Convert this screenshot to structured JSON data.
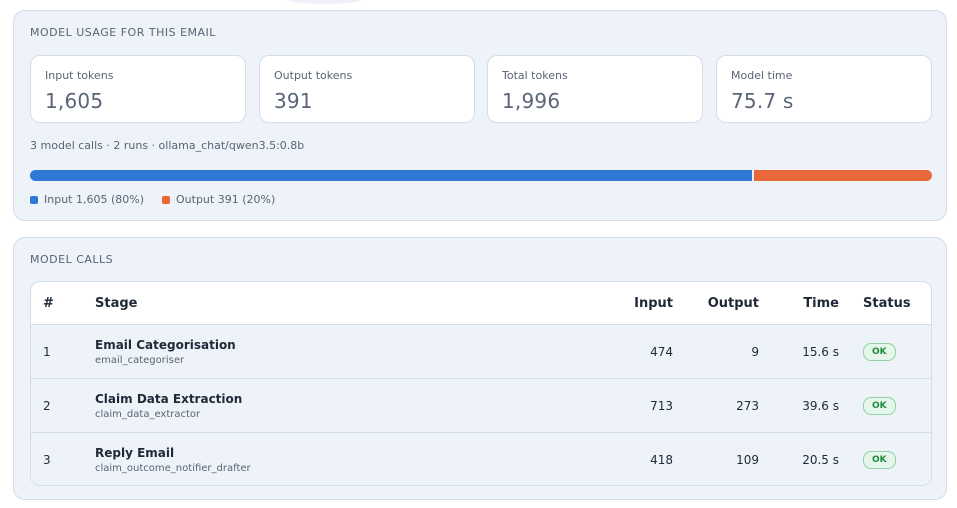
{
  "usage": {
    "title": "MODEL USAGE FOR THIS EMAIL",
    "stats": [
      {
        "label": "Input tokens",
        "value": "1,605"
      },
      {
        "label": "Output tokens",
        "value": "391"
      },
      {
        "label": "Total tokens",
        "value": "1,996"
      },
      {
        "label": "Model time",
        "value": "75.7 s"
      }
    ],
    "summary": "3 model calls · 2 runs · ollama_chat/qwen3.5:0.8b",
    "bar": {
      "input_fraction": 0.8,
      "output_fraction": 0.2
    },
    "legend": {
      "input": "Input 1,605 (80%)",
      "output": "Output 391 (20%)"
    },
    "colors": {
      "input": "#2f78d6",
      "output": "#e8683a"
    }
  },
  "calls": {
    "title": "MODEL CALLS",
    "headers": {
      "num": "#",
      "stage": "Stage",
      "input": "Input",
      "output": "Output",
      "time": "Time",
      "status": "Status"
    },
    "rows": [
      {
        "num": "1",
        "stage": "Email Categorisation",
        "stage_id": "email_categoriser",
        "input": "474",
        "output": "9",
        "time": "15.6 s",
        "status": "OK"
      },
      {
        "num": "2",
        "stage": "Claim Data Extraction",
        "stage_id": "claim_data_extractor",
        "input": "713",
        "output": "273",
        "time": "39.6 s",
        "status": "OK"
      },
      {
        "num": "3",
        "stage": "Reply Email",
        "stage_id": "claim_outcome_notifier_drafter",
        "input": "418",
        "output": "109",
        "time": "20.5 s",
        "status": "OK"
      }
    ]
  }
}
